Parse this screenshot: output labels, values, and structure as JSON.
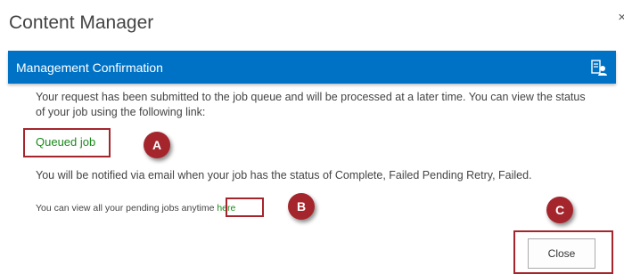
{
  "dialog": {
    "title": "Content Manager",
    "close_glyph": "×"
  },
  "header": {
    "title": "Management Confirmation",
    "icon": "settings-user-icon",
    "background": "#0072c6"
  },
  "content": {
    "submitted_text": "Your request has been submitted to the job queue and will be processed at a later time. You can view the status of your job using the following link:",
    "queued_link_label": "Queued job",
    "notify_text": "You will be notified via email when your job has the status of Complete, Failed Pending Retry, Failed.",
    "pending_text": "You can view all your pending jobs anytime",
    "here_link_label": "here"
  },
  "annotations": {
    "a": "A",
    "b": "B",
    "c": "C",
    "color": "#a4262c"
  },
  "footer": {
    "close_label": "Close"
  },
  "colors": {
    "link": "#1a8a1a",
    "body_text": "#444444"
  }
}
